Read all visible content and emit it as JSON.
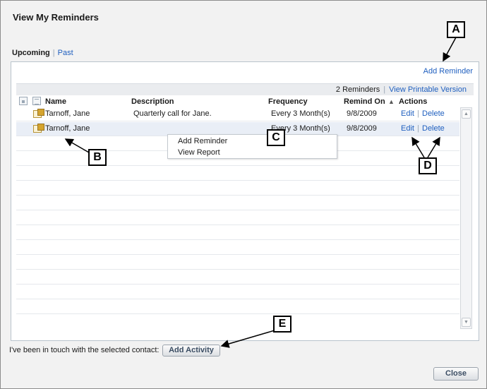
{
  "dialog": {
    "title": "View My Reminders"
  },
  "tabs": {
    "upcoming": "Upcoming",
    "past": "Past"
  },
  "panel": {
    "add_reminder": "Add Reminder",
    "count": "2 Reminders",
    "printable": "View Printable Version"
  },
  "columns": {
    "name": "Name",
    "description": "Description",
    "frequency": "Frequency",
    "remind_on": "Remind On",
    "actions": "Actions"
  },
  "rows": [
    {
      "name": "Tarnoff, Jane",
      "description": "Quarterly call for Jane.",
      "frequency": "Every 3 Month(s)",
      "remind_on": "9/8/2009",
      "edit": "Edit",
      "delete": "Delete"
    },
    {
      "name": "Tarnoff, Jane",
      "description": "",
      "frequency": "Every 3 Month(s)",
      "remind_on": "9/8/2009",
      "edit": "Edit",
      "delete": "Delete"
    }
  ],
  "context_menu": {
    "item1": "Add Reminder",
    "item2": "View Report"
  },
  "footer": {
    "contact_text": "I've been in touch with the selected contact:",
    "add_activity": "Add Activity",
    "close": "Close"
  },
  "callouts": {
    "a": "A",
    "b": "B",
    "c": "C",
    "d": "D",
    "e": "E"
  },
  "colors": {
    "link": "#1f5fbf",
    "selected_row": "#e9eef6",
    "dialog_bg": "#f2f2f2"
  }
}
